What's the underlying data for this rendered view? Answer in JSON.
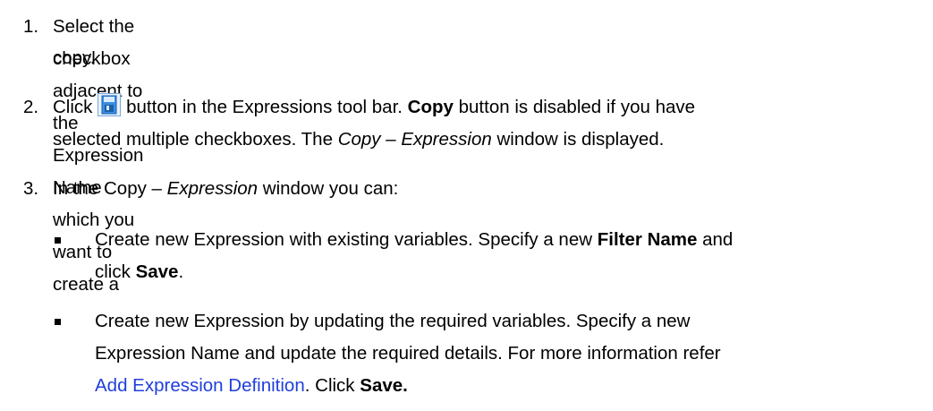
{
  "steps": [
    {
      "number": "1.",
      "line1": "Select the checkbox adjacent to the Expression Name which you want to create a",
      "line2": "copy."
    },
    {
      "number": "2.",
      "lead": "Click",
      "after_icon": "button in the Expressions tool bar.",
      "copy_bold": "Copy",
      "rest1": "button is disabled if you have",
      "line2_a": "selected multiple checkboxes. The",
      "line2_i": "Copy – Expression",
      "line2_b": "window is displayed."
    },
    {
      "number": "3.",
      "a": "In the Copy –",
      "i": "Expression",
      "b": "window you can:"
    }
  ],
  "bullets": [
    {
      "l1_a": "Create new Expression with existing variables. Specify a new",
      "l1_bold": "Filter Name",
      "l1_b": "and",
      "l2_a": "click",
      "l2_bold": "Save",
      "l2_b": "."
    },
    {
      "l1": "Create new Expression by updating the required variables. Specify a new",
      "l2": "Expression Name and update the required details. For more information refer",
      "link": "Add Expression Definition",
      "l3_b": ". Click",
      "l3_bold": "Save."
    }
  ],
  "icon": "copy-icon",
  "colors": {
    "link": "#1f3fdb",
    "icon_blue": "#3a8ee6"
  }
}
